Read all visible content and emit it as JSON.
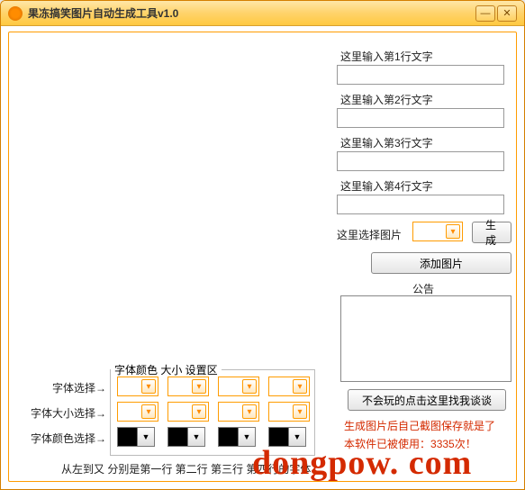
{
  "window": {
    "title": "果冻搞笑图片自动生成工具v1.0",
    "minimize": "—",
    "close": "✕"
  },
  "inputs": {
    "line1_label": "这里输入第1行文字",
    "line2_label": "这里输入第2行文字",
    "line3_label": "这里输入第3行文字",
    "line4_label": "这里输入第4行文字",
    "image_select_label": "这里选择图片",
    "generate_btn": "生成",
    "add_image_btn": "添加图片"
  },
  "notice": {
    "title": "公告",
    "help_btn": "不会玩的点击这里找我谈谈"
  },
  "font_section": {
    "group_label": "字体颜色 大小 设置区",
    "font_select_label": "字体选择→",
    "font_size_label": "字体大小选择→",
    "font_color_label": "字体颜色选择→",
    "footer_hint": "从左到又 分别是第一行 第二行 第三行 第四行的字体",
    "colors": [
      "#000000",
      "#000000",
      "#000000",
      "#000000"
    ]
  },
  "status": {
    "hint1": "生成图片后自己截图保存就是了",
    "hint2_prefix": "本软件已被使用：",
    "hint2_count": "3335",
    "hint2_suffix": "次！"
  },
  "watermark": "dongpow. com"
}
